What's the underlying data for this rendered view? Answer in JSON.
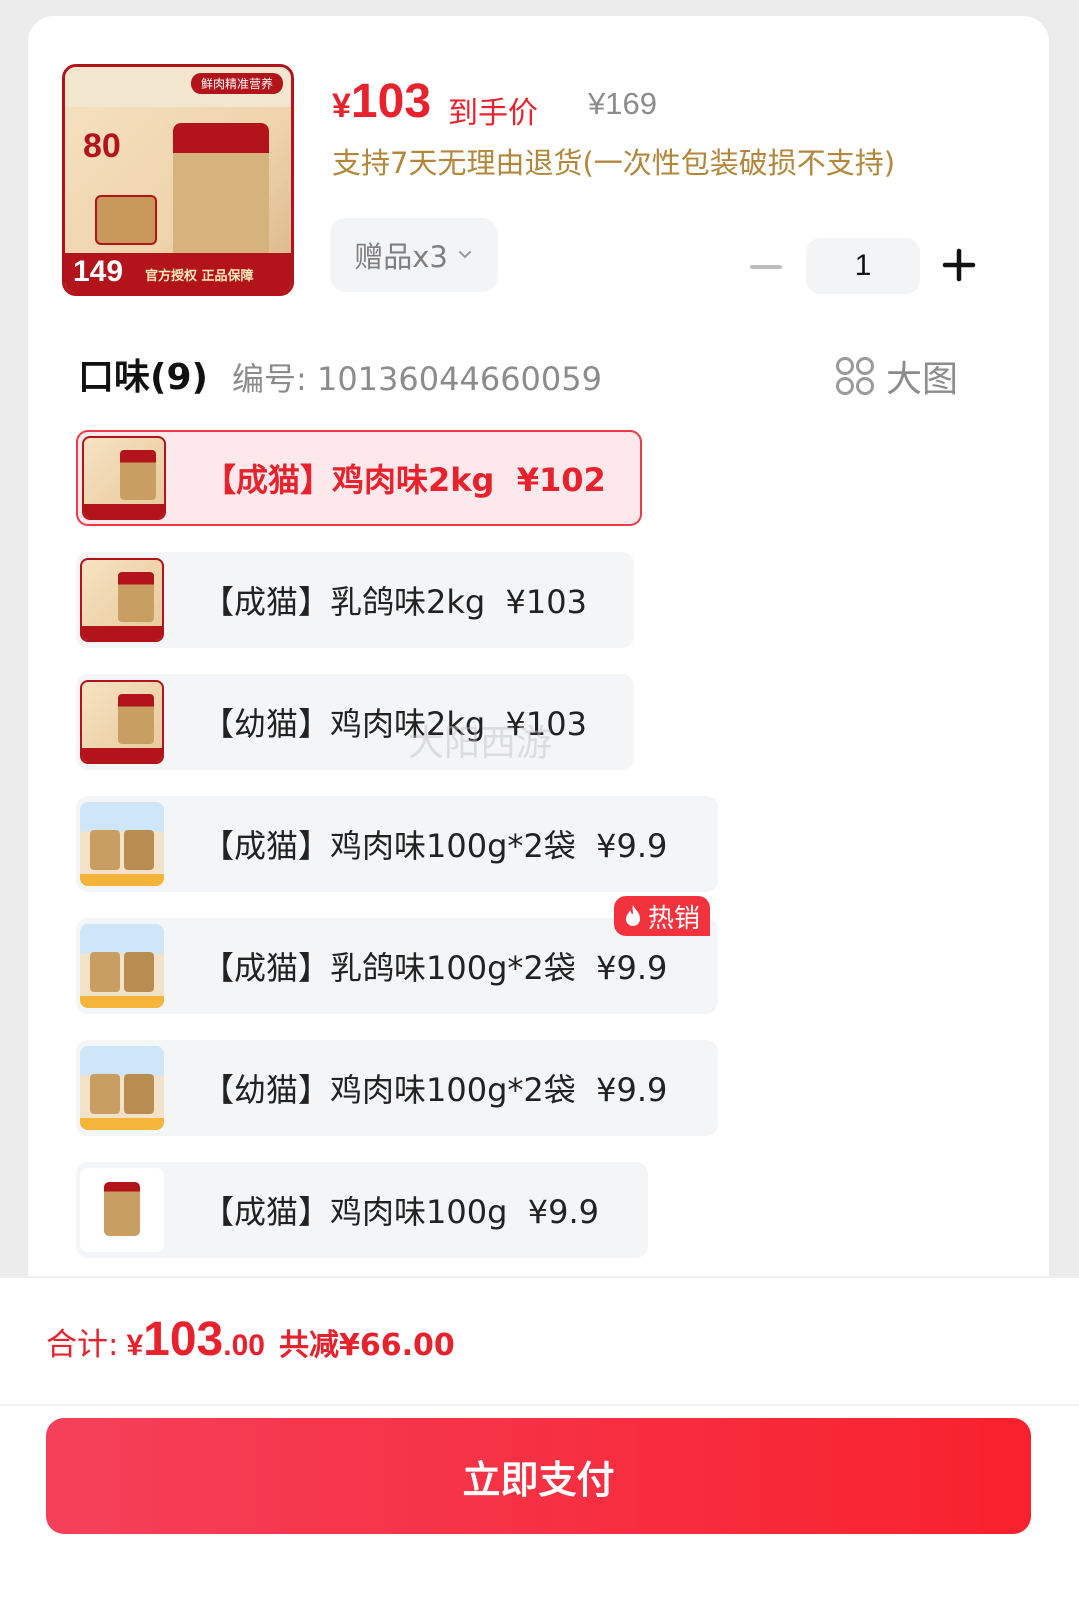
{
  "product": {
    "thumb_tag": "鲜肉精准营养",
    "thumb_big": "80",
    "thumb_price": "149",
    "thumb_auth": "官方授权 正品保障",
    "price_yen": "¥",
    "price_value": "103",
    "price_label": "到手价",
    "original_price": "¥169",
    "return_note": "支持7天无理由退货(一次性包装破损不支持)"
  },
  "gift": {
    "label": "赠品x3",
    "icon": "chevron-down-icon"
  },
  "quantity": {
    "value": "1",
    "minus_icon": "minus-icon",
    "plus_icon": "plus-icon"
  },
  "flavors": {
    "title": "口味(9)",
    "sku": "编号: 10136044660059",
    "big_image_label": "大图",
    "options": [
      {
        "label": "【成猫】鸡肉味2kg  ¥102",
        "selected": true
      },
      {
        "label": "【成猫】乳鸽味2kg  ¥103",
        "selected": false
      },
      {
        "label": "【幼猫】鸡肉味2kg  ¥103",
        "selected": false
      },
      {
        "label": "【成猫】鸡肉味100g*2袋  ¥9.9",
        "selected": false
      },
      {
        "label": "【成猫】乳鸽味100g*2袋  ¥9.9",
        "selected": false,
        "badge": "热销"
      },
      {
        "label": "【幼猫】鸡肉味100g*2袋  ¥9.9",
        "selected": false
      },
      {
        "label": "【成猫】鸡肉味100g  ¥9.9",
        "selected": false
      }
    ]
  },
  "watermark": "大阳西游",
  "summary": {
    "label": "合计:",
    "yen": "¥",
    "integer": "103",
    "decimal": ".00",
    "savings": "共减¥66.00"
  },
  "pay_button": "立即支付",
  "colors": {
    "accent": "#e8222d",
    "gold": "#b2873c",
    "brand_red": "#b3141c"
  }
}
